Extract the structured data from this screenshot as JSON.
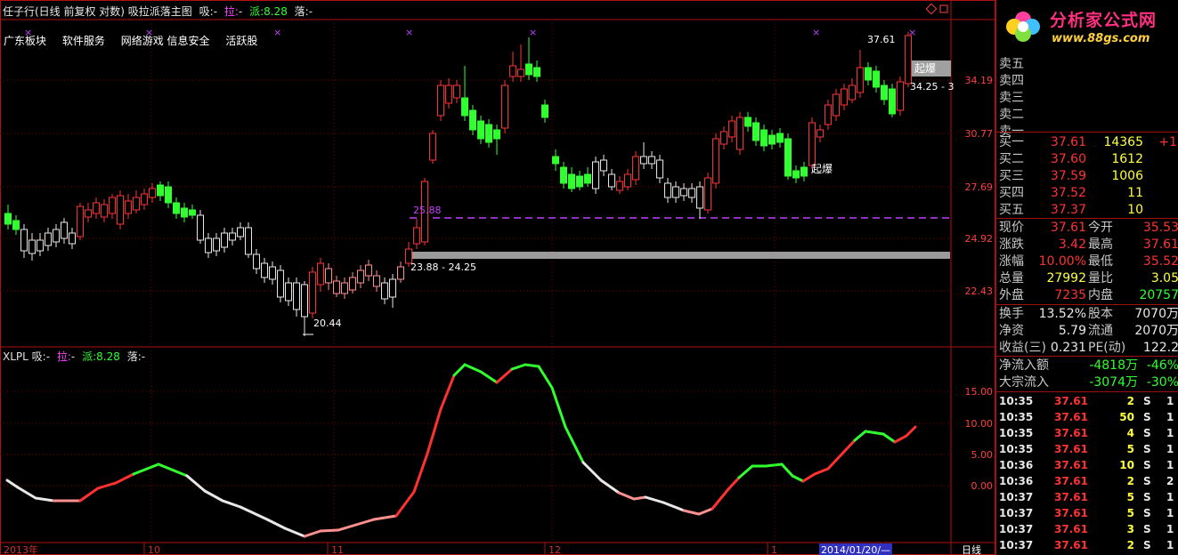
{
  "title": {
    "name": "任子行(日线 前复权 对数) 吸拉派落主图",
    "xi_label": "吸:",
    "xi_value": "-",
    "la_label": "拉:",
    "la_value": "-",
    "pai_label": "派:",
    "pai_value": "8.28",
    "luo_label": "落:",
    "luo_value": "-"
  },
  "sector_tags": [
    "广东板块",
    "软件服务",
    "网络游戏 信息安全",
    "活跃股"
  ],
  "price_axis": [
    "34.19",
    "30.77",
    "27.69",
    "24.92",
    "22.43"
  ],
  "price_annotations": {
    "high_left": "37.61",
    "high_tag": "起爆",
    "range_right": "34.25 - 3",
    "mid_tag": "起爆",
    "purple_level": "25.88",
    "support_range": "23.88 - 24.25",
    "low": "20.44"
  },
  "indicator": {
    "name": "XLPL",
    "xi_label": "吸:",
    "xi_value": "-",
    "la_label": "拉:",
    "la_value": "-",
    "pai_label": "派:",
    "pai_value": "8.28",
    "luo_label": "落:",
    "luo_value": "-",
    "axis": [
      "15.00",
      "10.00",
      "5.00",
      "0.00"
    ]
  },
  "date_axis": {
    "labels": [
      "2013年",
      "10",
      "11",
      "12",
      "1"
    ],
    "cursor_date": "2014/01/20/—",
    "period": "日线"
  },
  "colors": {
    "up": "#ff3232",
    "down": "#30ff30",
    "purple": "#c040ff",
    "grid": "#8b0000"
  },
  "panel": {
    "logo_text": "分析家公式网",
    "logo_url": "www.88gs.com",
    "asks": [
      {
        "label": "卖五"
      },
      {
        "label": "卖四"
      },
      {
        "label": "卖三"
      },
      {
        "label": "卖二"
      },
      {
        "label": "卖一"
      }
    ],
    "bids": [
      {
        "label": "买一",
        "price": "37.61",
        "vol": "14365",
        "chg": "+1"
      },
      {
        "label": "买二",
        "price": "37.60",
        "vol": "1612",
        "chg": ""
      },
      {
        "label": "买三",
        "price": "37.59",
        "vol": "1006",
        "chg": ""
      },
      {
        "label": "买四",
        "price": "37.52",
        "vol": "11",
        "chg": ""
      },
      {
        "label": "买五",
        "price": "37.37",
        "vol": "10",
        "chg": ""
      }
    ],
    "quote": [
      {
        "l1": "现价",
        "v1": "37.61",
        "l2": "今开",
        "v2": "35.53"
      },
      {
        "l1": "涨跌",
        "v1": "3.42",
        "l2": "最高",
        "v2": "37.61"
      },
      {
        "l1": "涨幅",
        "v1": "10.00%",
        "l2": "最低",
        "v2": "35.52"
      },
      {
        "l1": "总量",
        "v1": "27992",
        "l2": "量比",
        "v2": "3.05"
      },
      {
        "l1": "外盘",
        "v1": "7235",
        "l2": "内盘",
        "v2": "20757"
      }
    ],
    "info": [
      {
        "l1": "换手",
        "v1": "13.52%",
        "l2": "股本",
        "v2": "7070万"
      },
      {
        "l1": "净资",
        "v1": "5.79",
        "l2": "流通",
        "v2": "2070万"
      },
      {
        "l1": "收益(三)",
        "v1": "0.231",
        "l2": "PE(动)",
        "v2": "122.2"
      }
    ],
    "flow": [
      {
        "label": "净流入额",
        "value": "-4818万",
        "pct": "-46%"
      },
      {
        "label": "大宗流入",
        "value": "-3074万",
        "pct": "-30%"
      }
    ],
    "ticks": [
      {
        "time": "10:35",
        "price": "37.61",
        "vol": "2",
        "side": "S",
        "n": "1"
      },
      {
        "time": "10:35",
        "price": "37.61",
        "vol": "50",
        "side": "S",
        "n": "1"
      },
      {
        "time": "10:35",
        "price": "37.61",
        "vol": "4",
        "side": "S",
        "n": "1"
      },
      {
        "time": "10:35",
        "price": "37.61",
        "vol": "5",
        "side": "S",
        "n": "1"
      },
      {
        "time": "10:36",
        "price": "37.61",
        "vol": "10",
        "side": "S",
        "n": "1"
      },
      {
        "time": "10:36",
        "price": "37.61",
        "vol": "2",
        "side": "S",
        "n": "2"
      },
      {
        "time": "10:37",
        "price": "37.61",
        "vol": "5",
        "side": "S",
        "n": "1"
      },
      {
        "time": "10:37",
        "price": "37.61",
        "vol": "5",
        "side": "S",
        "n": "1"
      },
      {
        "time": "10:37",
        "price": "37.61",
        "vol": "3",
        "side": "S",
        "n": "1"
      },
      {
        "time": "10:37",
        "price": "37.61",
        "vol": "2",
        "side": "S",
        "n": "1"
      }
    ]
  }
}
